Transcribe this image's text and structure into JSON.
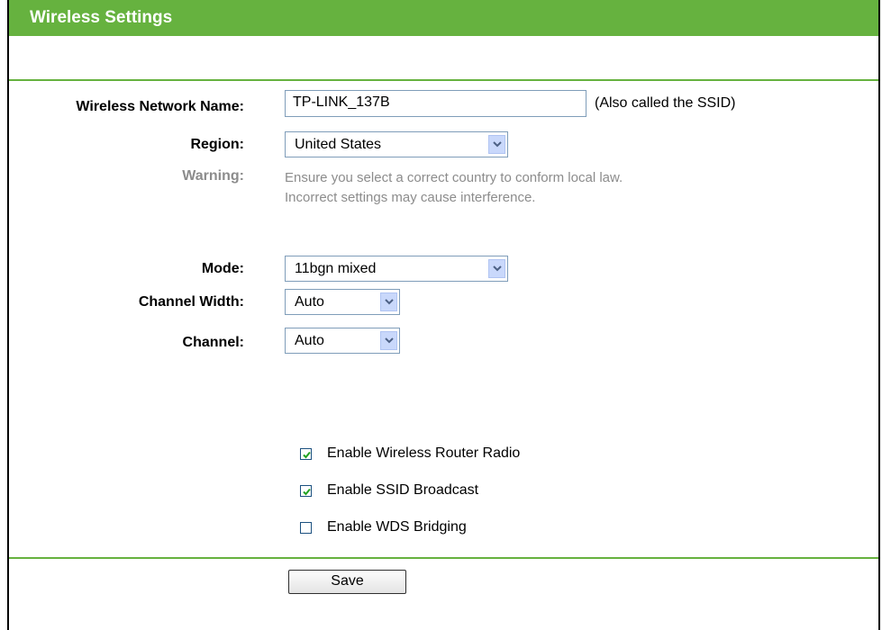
{
  "page": {
    "title": "Wireless Settings"
  },
  "form": {
    "network_name": {
      "label": "Wireless Network Name:",
      "value": "TP-LINK_137B",
      "hint": "(Also called the SSID)"
    },
    "region": {
      "label": "Region:",
      "value": "United States"
    },
    "warning": {
      "label": "Warning:",
      "line1": "Ensure you select a correct country to conform local law.",
      "line2": "Incorrect settings may cause interference."
    },
    "mode": {
      "label": "Mode:",
      "value": "11bgn mixed"
    },
    "channel_width": {
      "label": "Channel Width:",
      "value": "Auto"
    },
    "channel": {
      "label": "Channel:",
      "value": "Auto"
    },
    "options": [
      {
        "label": "Enable Wireless Router Radio",
        "checked": true
      },
      {
        "label": "Enable SSID Broadcast",
        "checked": true
      },
      {
        "label": "Enable WDS Bridging",
        "checked": false
      }
    ]
  },
  "actions": {
    "save_label": "Save"
  },
  "colors": {
    "accent": "#66b23f",
    "muted": "#8c8c8c",
    "input_border": "#7f9db9"
  }
}
